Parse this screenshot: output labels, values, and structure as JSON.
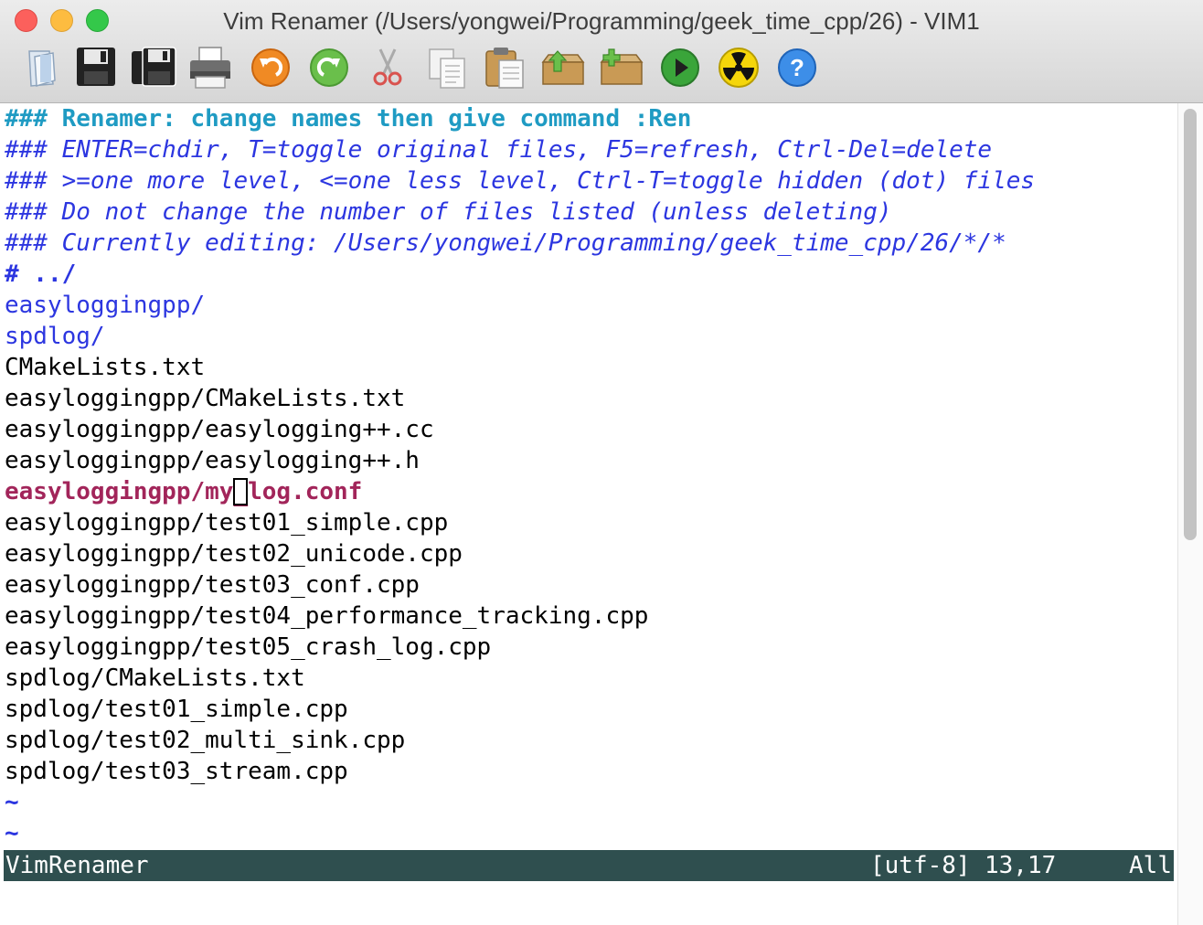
{
  "window": {
    "title": "Vim Renamer (/Users/yongwei/Programming/geek_time_cpp/26) - VIM1"
  },
  "toolbar": {
    "buttons": [
      {
        "icon": "open-file-icon"
      },
      {
        "icon": "save-icon"
      },
      {
        "icon": "save-all-icon"
      },
      {
        "icon": "print-icon"
      },
      {
        "icon": "undo-icon"
      },
      {
        "icon": "redo-icon"
      },
      {
        "icon": "cut-icon"
      },
      {
        "icon": "copy-icon"
      },
      {
        "icon": "paste-icon"
      },
      {
        "icon": "load-session-icon"
      },
      {
        "icon": "save-session-icon"
      },
      {
        "icon": "run-script-icon"
      },
      {
        "icon": "make-icon"
      },
      {
        "icon": "help-icon"
      }
    ]
  },
  "buffer": {
    "lines": [
      {
        "text": "### Renamer: change names then give command :Ren",
        "style": "head"
      },
      {
        "text": "### ENTER=chdir, T=toggle original files, F5=refresh, Ctrl-Del=delete",
        "style": "help"
      },
      {
        "text": "### >=one more level, <=one less level, Ctrl-T=toggle hidden (dot) files",
        "style": "help"
      },
      {
        "text": "### Do not change the number of files listed (unless deleting)",
        "style": "help"
      },
      {
        "text": "### Currently editing: /Users/yongwei/Programming/geek_time_cpp/26/*/*",
        "style": "help"
      },
      {
        "text": "# ../",
        "style": "dirbold"
      },
      {
        "text": "easyloggingpp/",
        "style": "dir"
      },
      {
        "text": "spdlog/",
        "style": "dir"
      },
      {
        "text": "CMakeLists.txt",
        "style": "file"
      },
      {
        "text": "easyloggingpp/CMakeLists.txt",
        "style": "file"
      },
      {
        "text": "easyloggingpp/easylogging++.cc",
        "style": "file"
      },
      {
        "text": "easyloggingpp/easylogging++.h",
        "style": "file"
      },
      {
        "text": "easyloggingpp/my_log.conf",
        "style": "current"
      },
      {
        "text": "easyloggingpp/test01_simple.cpp",
        "style": "file"
      },
      {
        "text": "easyloggingpp/test02_unicode.cpp",
        "style": "file"
      },
      {
        "text": "easyloggingpp/test03_conf.cpp",
        "style": "file"
      },
      {
        "text": "easyloggingpp/test04_performance_tracking.cpp",
        "style": "file"
      },
      {
        "text": "easyloggingpp/test05_crash_log.cpp",
        "style": "file"
      },
      {
        "text": "spdlog/CMakeLists.txt",
        "style": "file"
      },
      {
        "text": "spdlog/test01_simple.cpp",
        "style": "file"
      },
      {
        "text": "spdlog/test02_multi_sink.cpp",
        "style": "file"
      },
      {
        "text": "spdlog/test03_stream.cpp",
        "style": "file"
      },
      {
        "text": "~",
        "style": "tilde"
      },
      {
        "text": "~",
        "style": "tilde"
      }
    ],
    "cursor": {
      "line": 13,
      "column": 17
    }
  },
  "statusline": {
    "name": "VimRenamer",
    "encoding": "[utf-8]",
    "position": "13,17",
    "scroll": "All"
  },
  "colors": {
    "header": "#1f9bc3",
    "help": "#2c36e0",
    "directory": "#2c36e0",
    "current_line": "#a2255a",
    "statusline_bg": "#2f4f4f"
  }
}
